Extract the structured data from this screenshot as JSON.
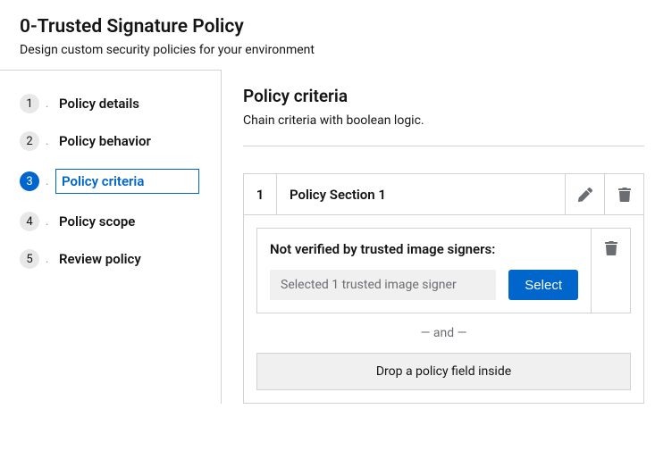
{
  "header": {
    "title": "0-Trusted Signature Policy",
    "subtitle": "Design custom security policies for your environment"
  },
  "wizard": {
    "steps": [
      {
        "number": "1",
        "label": "Policy details"
      },
      {
        "number": "2",
        "label": "Policy behavior"
      },
      {
        "number": "3",
        "label": "Policy criteria"
      },
      {
        "number": "4",
        "label": "Policy scope"
      },
      {
        "number": "5",
        "label": "Review policy"
      }
    ],
    "activeIndex": 2
  },
  "main": {
    "title": "Policy criteria",
    "subtitle": "Chain criteria with boolean logic."
  },
  "section": {
    "number": "1",
    "title": "Policy Section 1",
    "criteria": {
      "label": "Not verified by trusted image signers:",
      "inputValue": "Selected 1 trusted image signer",
      "selectLabel": "Select"
    },
    "connector": "— and —",
    "dropLabel": "Drop a policy field inside"
  }
}
